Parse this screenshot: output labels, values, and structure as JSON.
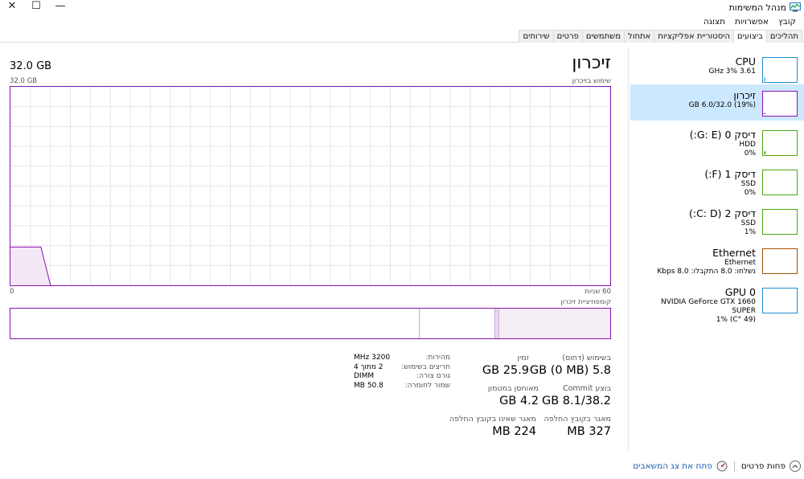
{
  "window": {
    "title": "מנהל המשימות",
    "close_glyph": "✕",
    "maximize_glyph": "☐",
    "minimize_glyph": "—"
  },
  "menu": [
    "קובץ",
    "אפשרויות",
    "תצוגה"
  ],
  "tabs": [
    {
      "label": "תהליכים",
      "active": false
    },
    {
      "label": "ביצועים",
      "active": true
    },
    {
      "label": "היסטוריית אפליקציות",
      "active": false
    },
    {
      "label": "אתחול",
      "active": false
    },
    {
      "label": "משתמשים",
      "active": false
    },
    {
      "label": "פרטים",
      "active": false
    },
    {
      "label": "שירותים",
      "active": false
    }
  ],
  "sidebar": {
    "items": [
      {
        "title": "CPU",
        "sub1": "3.61 GHz  3%",
        "sub2": "",
        "sub3": "",
        "color": "#1a8fd6",
        "selected": false
      },
      {
        "title": "זיכרון",
        "sub1": "(19%) 6.0/32.0 GB",
        "sub2": "",
        "sub3": "",
        "color": "#8b12ae",
        "selected": true
      },
      {
        "title": "דיסק 0 (G: E:)",
        "sub1": "HDD",
        "sub2": "0%",
        "sub3": "",
        "color": "#4da60c",
        "selected": false
      },
      {
        "title": "דיסק 1 (F:)",
        "sub1": "SSD",
        "sub2": "0%",
        "sub3": "",
        "color": "#4da60c",
        "selected": false
      },
      {
        "title": "דיסק 2 (C: D:)",
        "sub1": "SSD",
        "sub2": "1%",
        "sub3": "",
        "color": "#4da60c",
        "selected": false
      },
      {
        "title": "Ethernet",
        "sub1": "Ethernet",
        "sub2": "נשלחו: 8.0  התקבלו: 8.0 Kbps",
        "sub3": "",
        "color": "#a74f01",
        "selected": false
      },
      {
        "title": "GPU 0",
        "sub1": "NVIDIA GeForce GTX 1660 SUPER",
        "sub2": "(49 °C)  1%",
        "sub3": "",
        "color": "#1a8fd6",
        "selected": false
      }
    ]
  },
  "main": {
    "title": "זיכרון",
    "total": "32.0 GB",
    "graph_label": "שימוש בזיכרון",
    "graph_max": "32.0 GB",
    "axis_left": "0",
    "axis_right": "60 שניות",
    "composition_label": "קומפוזיציית זיכרון",
    "accent_color": "#8b12ae",
    "usage_fraction": 0.19
  },
  "stats": {
    "in_use_label": "בשימוש (דחוס)",
    "in_use_value": "5.8 GB (0 MB)",
    "available_label": "זמין",
    "available_value": "25.9 GB",
    "committed_label": "בוצע Commit",
    "committed_value": "8.1/38.2 GB",
    "cached_label": "מאוחסן במטמון",
    "cached_value": "4.2 GB",
    "paged_label": "מאגר בקובץ החלפה",
    "paged_value": "327 MB",
    "nonpaged_label": "מאגר שאינו בקובץ החלפה",
    "nonpaged_value": "224 MB"
  },
  "details": [
    {
      "key": "מהירות:",
      "value": "3200 MHz"
    },
    {
      "key": "חריצים בשימוש:",
      "value": "2 מתוך 4"
    },
    {
      "key": "גורם צורה:",
      "value": "DIMM"
    },
    {
      "key": "שמור לחומרה:",
      "value": "50.8 MB"
    }
  ],
  "footer": {
    "fewer_details": "פחות פרטים",
    "open_monitor": "פתח את צג המשאבים"
  }
}
